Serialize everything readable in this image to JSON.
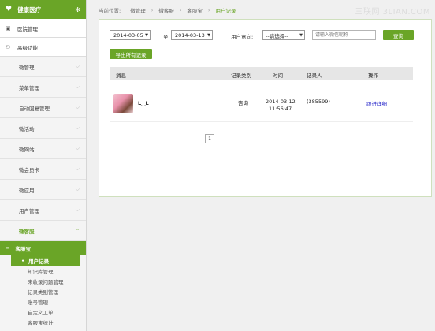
{
  "brand": {
    "title": "健康医疗"
  },
  "top_menu": [
    {
      "icon": "briefcase-icon",
      "glyph": "▣",
      "label": "医院管理"
    },
    {
      "icon": "users-icon",
      "glyph": "⚇",
      "label": "高级功能"
    }
  ],
  "nav": [
    {
      "key": "weiguanli",
      "label": "微管理",
      "active": false
    },
    {
      "key": "caidan",
      "label": "菜单管理",
      "active": false
    },
    {
      "key": "zidong",
      "label": "自动回复管理",
      "active": false
    },
    {
      "key": "huodong",
      "label": "微活动",
      "active": false
    },
    {
      "key": "wangzhan",
      "label": "微网站",
      "active": false
    },
    {
      "key": "huiyuanka",
      "label": "微会员卡",
      "active": false
    },
    {
      "key": "yingyong",
      "label": "微应用",
      "active": false
    },
    {
      "key": "yonghu",
      "label": "用户管理",
      "active": false
    },
    {
      "key": "kefu",
      "label": "微客服",
      "active": true
    }
  ],
  "submenu": {
    "title": "客服宝",
    "items": [
      {
        "label": "用户记录",
        "current": true
      },
      {
        "label": "知识库管理",
        "current": false
      },
      {
        "label": "未收录问题管理",
        "current": false
      },
      {
        "label": "记录类别管理",
        "current": false
      },
      {
        "label": "账号管理",
        "current": false
      },
      {
        "label": "自定义工单",
        "current": false
      },
      {
        "label": "客服宝统计",
        "current": false
      }
    ]
  },
  "breadcrumb": {
    "prefix": "当前位置:",
    "items": [
      "微管理",
      "微客服",
      "客服宝"
    ],
    "current": "用户记录"
  },
  "watermark": "三联网 3LIAN.COM",
  "filter": {
    "date_from": "2014-03-05",
    "to_label": "至",
    "date_to": "2014-03-13",
    "intent_label": "用户意向:",
    "intent_selected": "--请选择--",
    "search_placeholder": "请输入微信昵称",
    "query_label": "查询",
    "export_label": "导出所有记录"
  },
  "table": {
    "headers": {
      "message": "消息",
      "category": "记录类别",
      "time": "时间",
      "recorder": "记录人",
      "action": "操作"
    },
    "rows": [
      {
        "name": "L‿L",
        "category": "咨询",
        "date": "2014-03-12",
        "time": "11:56:47",
        "recorder": "(385599)",
        "action": "跟进详细"
      }
    ]
  },
  "pagination": {
    "current": "1"
  },
  "colors": {
    "accent": "#6aa527",
    "link": "#2a2acb"
  }
}
